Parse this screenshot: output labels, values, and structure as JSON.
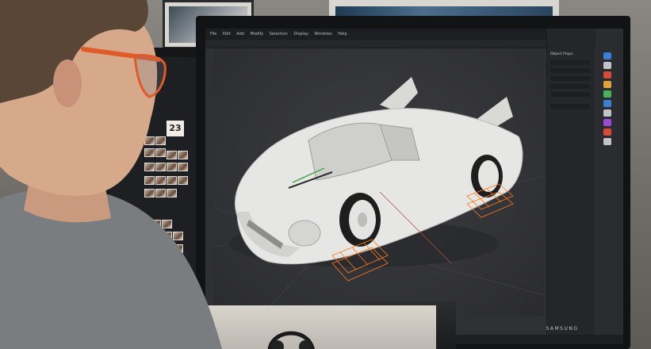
{
  "photo": {
    "description_free": true,
    "main_monitor": {
      "brand_logo": "SAMSUNG",
      "menu_items": [
        "File",
        "Edit",
        "Add",
        "Modify",
        "Selection",
        "Display",
        "Windows",
        "Help"
      ],
      "properties_title": "Object Props"
    },
    "left_monitor": {
      "reference_number": "23"
    }
  },
  "colors": {
    "car_body": "#e6e6e4",
    "wire_orange": "#ff7a1a",
    "wall": "#7b7873",
    "skin": "#d6a98b",
    "glasses": "#e05a2a",
    "shirt": "#7a7d80"
  }
}
